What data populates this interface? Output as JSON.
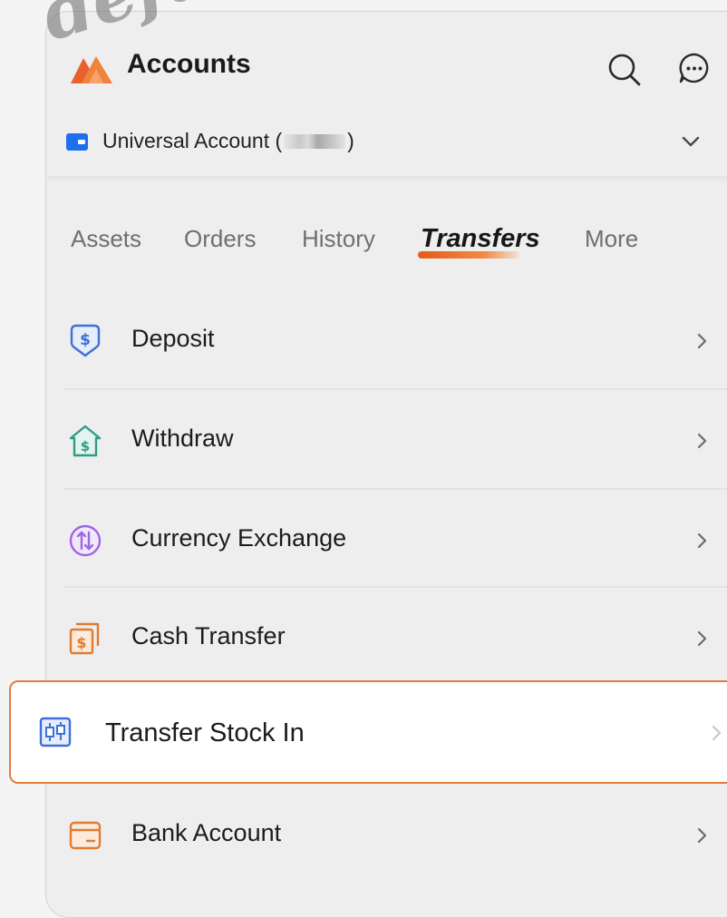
{
  "header": {
    "title": "Accounts",
    "logo_icon": "brand-logo-icon",
    "search_icon": "search-icon",
    "chat_icon": "chat-bubble-icon"
  },
  "account": {
    "prefix": "Universal Account (",
    "masked_number": "",
    "suffix": ")",
    "icon": "wallet-icon",
    "dropdown_icon": "chevron-down-icon"
  },
  "tabs": [
    {
      "label": "Assets",
      "active": false
    },
    {
      "label": "Orders",
      "active": false
    },
    {
      "label": "History",
      "active": false
    },
    {
      "label": "Transfers",
      "active": true
    },
    {
      "label": "More",
      "active": false
    }
  ],
  "menu": [
    {
      "label": "Deposit",
      "icon": "deposit-dollar-shield-icon",
      "color": "#3f6fd8"
    },
    {
      "label": "Withdraw",
      "icon": "withdraw-dollar-house-icon",
      "color": "#2f9c86"
    },
    {
      "label": "Currency Exchange",
      "icon": "currency-exchange-icon",
      "color": "#9e64e6"
    },
    {
      "label": "Cash Transfer",
      "icon": "cash-transfer-icon",
      "color": "#e07b32"
    },
    {
      "label": "Transfer Stock In",
      "icon": "transfer-stock-in-icon",
      "color": "#3f6fd8",
      "highlighted": true
    },
    {
      "label": "Bank Account",
      "icon": "bank-card-icon",
      "color": "#e07b32"
    }
  ],
  "watermark": "default",
  "colors": {
    "accent": "#e8622c",
    "highlight_border": "#e47c3c",
    "background": "#eeeeee"
  }
}
